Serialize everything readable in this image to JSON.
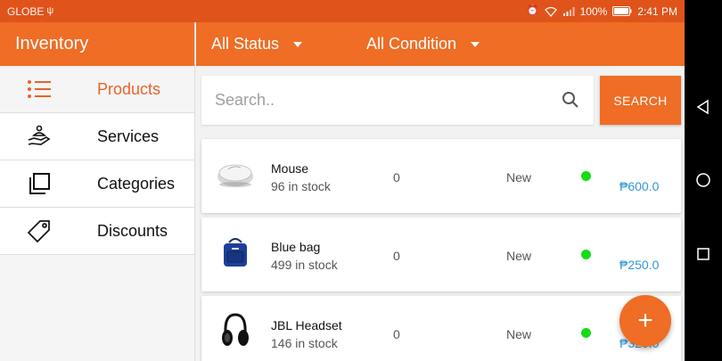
{
  "status_bar": {
    "carrier": "GLOBE",
    "battery": "100%",
    "time": "2:41 PM"
  },
  "sidebar": {
    "title": "Inventory",
    "items": [
      {
        "label": "Products",
        "icon": "list-icon",
        "active": true
      },
      {
        "label": "Services",
        "icon": "hand-service-icon",
        "active": false
      },
      {
        "label": "Categories",
        "icon": "copy-icon",
        "active": false
      },
      {
        "label": "Discounts",
        "icon": "tag-icon",
        "active": false
      }
    ]
  },
  "filters": {
    "status": "All Status",
    "condition": "All Condition"
  },
  "search": {
    "placeholder": "Search..",
    "button_label": "SEARCH"
  },
  "products": [
    {
      "name": "Mouse",
      "stock": "96  in stock",
      "qty": "0",
      "condition": "New",
      "price": "₱600.0",
      "image": "mouse-image"
    },
    {
      "name": "Blue bag",
      "stock": "499  in stock",
      "qty": "0",
      "condition": "New",
      "price": "₱250.0",
      "image": "bag-image"
    },
    {
      "name": "JBL Headset",
      "stock": "146  in stock",
      "qty": "0",
      "condition": "New",
      "price": "₱320.0",
      "image": "headset-image"
    }
  ],
  "fab": {
    "label": "+"
  },
  "colors": {
    "accent": "#ef6d25",
    "status_bar": "#e0531b",
    "active_text": "#e8622a",
    "price": "#3296d6",
    "status_dot": "#14dd14"
  }
}
